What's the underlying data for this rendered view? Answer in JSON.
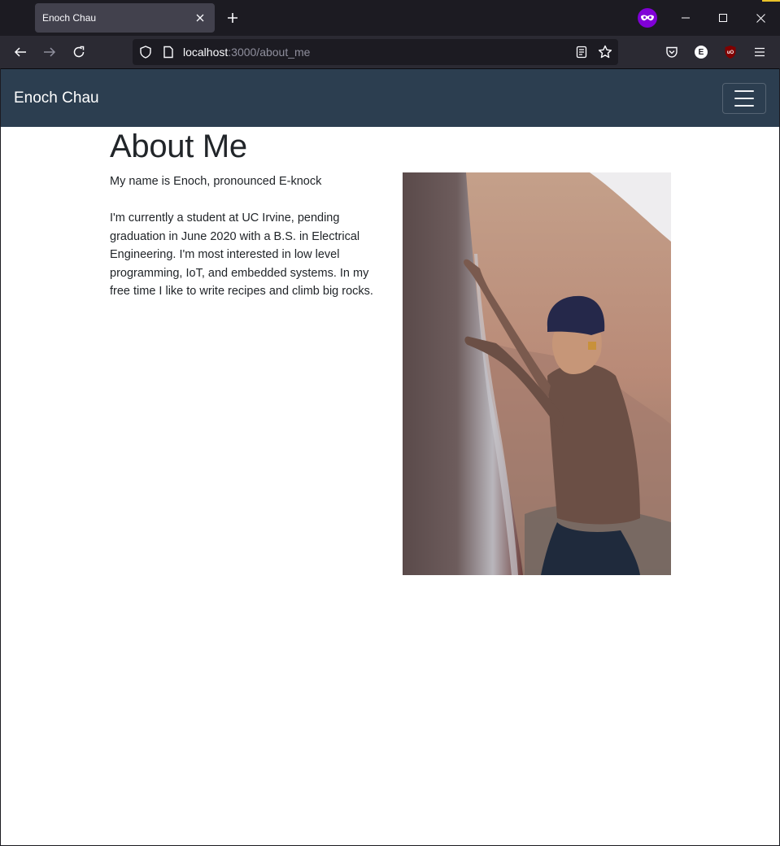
{
  "browser": {
    "tab": {
      "title": "Enoch Chau"
    },
    "url": {
      "host": "localhost",
      "rest": ":3000/about_me"
    },
    "toolbar_ext_letter": "E",
    "ublock_label": "uO"
  },
  "site": {
    "brand": "Enoch Chau",
    "page_title": "About Me",
    "bio": {
      "intro": "My name is Enoch, pronounced E-knock",
      "details": "I'm currently a student at UC Irvine, pending graduation in June 2020 with a B.S. in Electrical Engineering. I'm most interested in low level programming, IoT, and embedded systems. In my free time I like to write recipes and climb big rocks."
    },
    "photo_alt": "Climbing photo"
  },
  "colors": {
    "tab_strip": "#1c1b22",
    "site_nav": "#2c3e50",
    "private_badge": "#8000d7"
  }
}
